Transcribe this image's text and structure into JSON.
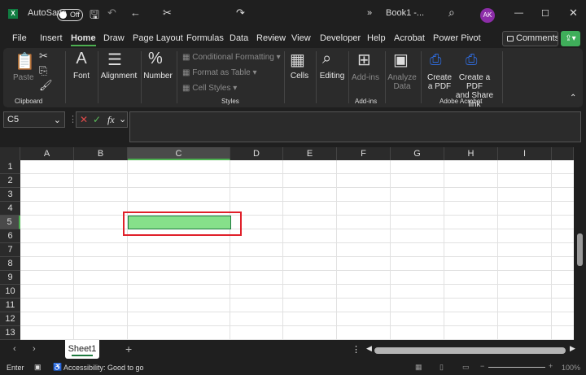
{
  "titlebar": {
    "app_icon": "X",
    "autosave_label": "AutoSave",
    "autosave_state": "Off",
    "doc_title": "Book1 -...",
    "avatar_initials": "AK",
    "overflow": "»"
  },
  "tabs": [
    "File",
    "Insert",
    "Home",
    "Draw",
    "Page Layout",
    "Formulas",
    "Data",
    "Review",
    "View",
    "Developer",
    "Help",
    "Acrobat",
    "Power Pivot"
  ],
  "active_tab": "Home",
  "comments_label": "Comments",
  "ribbon": {
    "paste": "Paste",
    "clipboard": "Clipboard",
    "font": "Font",
    "alignment": "Alignment",
    "number": "Number",
    "conditional_formatting": "Conditional Formatting",
    "format_as_table": "Format as Table",
    "cell_styles": "Cell Styles",
    "styles": "Styles",
    "cells": "Cells",
    "editing": "Editing",
    "addins": "Add-ins",
    "addins_group": "Add-ins",
    "analyze1": "Analyze",
    "analyze2": "Data",
    "create_pdf1": "Create",
    "create_pdf2": "a PDF",
    "share_pdf1": "Create a PDF",
    "share_pdf2": "and Share link",
    "acrobat_group": "Adobe Acrobat"
  },
  "formula_bar": {
    "name_box": "C5",
    "fx": "fx",
    "formula": ""
  },
  "columns": [
    "A",
    "B",
    "C",
    "D",
    "E",
    "F",
    "G",
    "H",
    "I"
  ],
  "rows": [
    "1",
    "2",
    "3",
    "4",
    "5",
    "6",
    "7",
    "8",
    "9",
    "10",
    "11",
    "12",
    "13"
  ],
  "selected_cell": "C5",
  "colors": {
    "selected_fill": "#86e08a",
    "highlight_box": "#e0202a",
    "accent": "#4caf50"
  },
  "sheets": [
    "Sheet1"
  ],
  "status": {
    "mode": "Enter",
    "accessibility": "Accessibility: Good to go",
    "zoom": "100%"
  }
}
